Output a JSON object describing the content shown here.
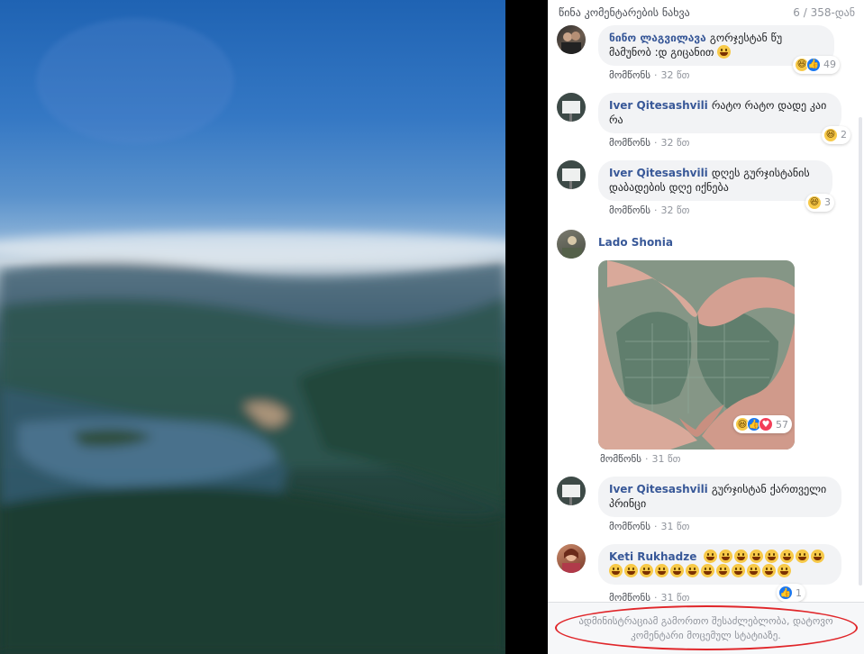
{
  "header": {
    "prev_comments": "წინა კომენტარების ნახვა",
    "counter": "6 / 358-დან"
  },
  "actions": {
    "like_label": "მომწონს",
    "separator": "·"
  },
  "comments": [
    {
      "author": "ნინო ლაგვილავა",
      "text": "გორჯესტან წუ მამუნობ :დ გიცანით",
      "has_inline_emoji": true,
      "time": "32 წთ",
      "reactions": [
        "haha",
        "like"
      ],
      "reaction_count": "49"
    },
    {
      "author": "Iver Qitesashvili",
      "text": "რატო რატო დადე კაი რა",
      "time": "32 წთ",
      "reactions": [
        "haha"
      ],
      "reaction_count": "2"
    },
    {
      "author": "Iver Qitesashvili",
      "text": "დღეს გურჯისტანის დაბადების დღე იქნება",
      "time": "32 წთ",
      "reactions": [
        "haha"
      ],
      "reaction_count": "3"
    },
    {
      "author": "Lado Shonia",
      "text": "",
      "attachment": "heart-hands-image",
      "time": "31 წთ",
      "reactions": [
        "haha",
        "like",
        "love"
      ],
      "reaction_count": "57"
    },
    {
      "author": "Iver Qitesashvili",
      "text": "გურჯისტან ქართველი პრინცი",
      "time": "31 წთ",
      "reactions": [],
      "reaction_count": ""
    },
    {
      "author": "Keti Rukhadze",
      "text": "",
      "emoji_count": 20,
      "time": "31 წთ",
      "reactions": [
        "like"
      ],
      "reaction_count": "1"
    }
  ],
  "footer": {
    "note": "ადმინისტრაციამ გამორთო შესაძლებლობა, დატოვო კომენტარი მოცემულ სტატიაზე."
  },
  "colors": {
    "author_link": "#385898",
    "bubble_bg": "#f2f3f5",
    "highlight_circle": "#e0262a"
  }
}
